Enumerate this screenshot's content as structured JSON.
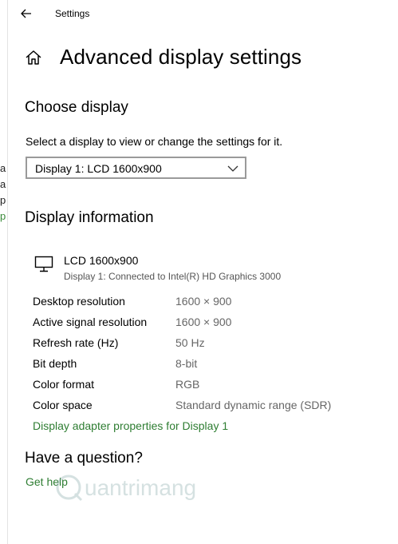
{
  "app": {
    "title": "Settings"
  },
  "header": {
    "page_title": "Advanced display settings"
  },
  "choose_display": {
    "heading": "Choose display",
    "description": "Select a display to view or change the settings for it.",
    "selected": "Display 1: LCD 1600x900"
  },
  "display_info": {
    "heading": "Display information",
    "monitor_name": "LCD 1600x900",
    "monitor_subtitle": "Display 1: Connected to Intel(R) HD Graphics 3000",
    "rows": [
      {
        "label": "Desktop resolution",
        "value": "1600 × 900"
      },
      {
        "label": "Active signal resolution",
        "value": "1600 × 900"
      },
      {
        "label": "Refresh rate (Hz)",
        "value": "50 Hz"
      },
      {
        "label": "Bit depth",
        "value": "8-bit"
      },
      {
        "label": "Color format",
        "value": "RGB"
      },
      {
        "label": "Color space",
        "value": "Standard dynamic range (SDR)"
      }
    ],
    "adapter_link": "Display adapter properties for Display 1"
  },
  "question": {
    "heading": "Have a question?",
    "help_link": "Get help"
  },
  "background_fragments": [
    "a",
    "a",
    "p",
    "p"
  ],
  "watermark": "uantrimang",
  "colors": {
    "link": "#2e7d32",
    "value_gray": "#666666",
    "border": "#9a9a9a"
  },
  "icons": {
    "back": "arrow-left-icon",
    "home": "home-icon",
    "chevron": "chevron-down-icon",
    "monitor": "monitor-icon"
  }
}
